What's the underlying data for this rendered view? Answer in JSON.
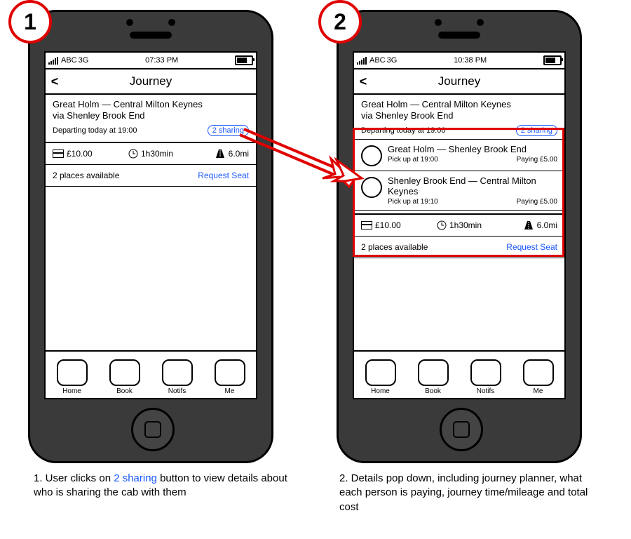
{
  "badges": {
    "one": "1",
    "two": "2"
  },
  "captions": {
    "c1_prefix": "1. User clicks on ",
    "c1_link": "2 sharing",
    "c1_suffix": " button to view details about who is sharing the cab with them",
    "c2": "2. Details pop down, including journey planner, what each person is paying, journey time/mileage and total cost"
  },
  "phone1": {
    "status": {
      "carrier": "ABC",
      "net": "3G",
      "time": "07:33 PM"
    },
    "nav": {
      "back": "<",
      "title": "Journey"
    },
    "journey": {
      "title_line1": "Great Holm — Central Milton Keynes",
      "title_line2": "via Shenley Brook End",
      "depart": "Departing today at 19:00",
      "sharing": "2 sharing"
    },
    "stats": {
      "price": "£10.00",
      "duration": "1h30min",
      "distance": "6.0mi"
    },
    "avail": {
      "places": "2 places available",
      "request": "Request Seat"
    },
    "tabs": [
      "Home",
      "Book",
      "Notifs",
      "Me"
    ]
  },
  "phone2": {
    "status": {
      "carrier": "ABC",
      "net": "3G",
      "time": "10:38 PM"
    },
    "nav": {
      "back": "<",
      "title": "Journey"
    },
    "journey": {
      "title_line1": "Great Holm — Central Milton Keynes",
      "title_line2": "via Shenley Brook End",
      "depart": "Departing today at 19:00",
      "sharing": "2 sharing"
    },
    "segments": [
      {
        "title": "Great Holm — Shenley Brook End",
        "pickup": "Pick up at 19:00",
        "paying": "Paying £5.00"
      },
      {
        "title": "Shenley Brook End — Central Milton Keynes",
        "pickup": "Pick up at 19:10",
        "paying": "Paying £5.00"
      }
    ],
    "stats": {
      "price": "£10.00",
      "duration": "1h30min",
      "distance": "6.0mi"
    },
    "avail": {
      "places": "2 places available",
      "request": "Request Seat"
    },
    "tabs": [
      "Home",
      "Book",
      "Notifs",
      "Me"
    ]
  }
}
